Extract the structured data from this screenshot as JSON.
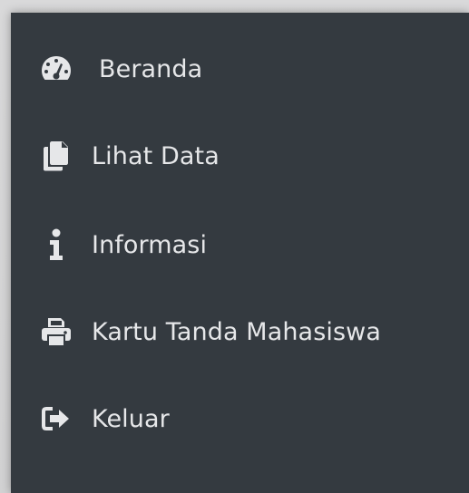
{
  "sidebar": {
    "items": [
      {
        "label": "Beranda",
        "icon": "dashboard-gauge-icon"
      },
      {
        "label": "Lihat Data",
        "icon": "copy-files-icon"
      },
      {
        "label": "Informasi",
        "icon": "info-icon"
      },
      {
        "label": "Kartu Tanda Mahasiswa",
        "icon": "print-icon"
      },
      {
        "label": "Keluar",
        "icon": "sign-out-icon"
      }
    ]
  },
  "colors": {
    "sidebar_bg": "#343a40",
    "text": "#e6e7e9",
    "background": "#d9d9da"
  }
}
